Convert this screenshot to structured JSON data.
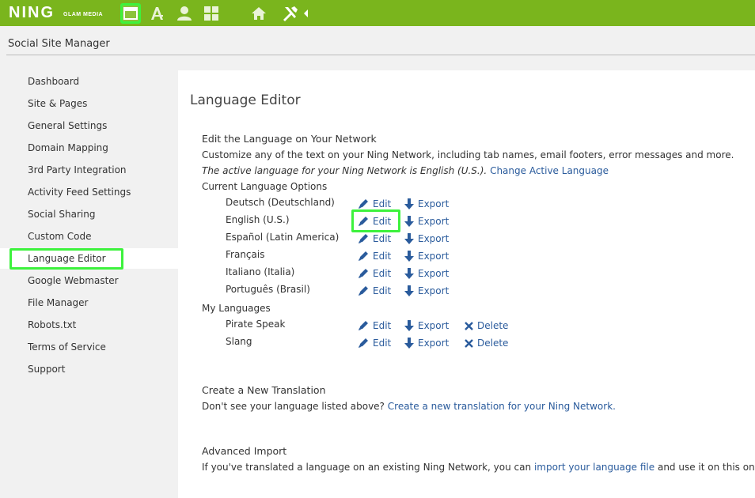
{
  "topbar": {
    "logo": "NING",
    "logo_sub": "GLAM MEDIA",
    "icons": [
      "window-icon",
      "appearance-icon",
      "profile-icon",
      "features-icon",
      "home-icon",
      "tools-icon",
      "chevron-left-icon"
    ]
  },
  "header": {
    "title": "Social Site Manager"
  },
  "sidebar": {
    "items": [
      {
        "label": "Dashboard"
      },
      {
        "label": "Site & Pages"
      },
      {
        "label": "General Settings"
      },
      {
        "label": "Domain Mapping"
      },
      {
        "label": "3rd Party Integration"
      },
      {
        "label": "Activity Feed Settings"
      },
      {
        "label": "Social Sharing"
      },
      {
        "label": "Custom Code"
      },
      {
        "label": "Language Editor"
      },
      {
        "label": "Google Webmaster"
      },
      {
        "label": "File Manager"
      },
      {
        "label": "Robots.txt"
      },
      {
        "label": "Terms of Service"
      },
      {
        "label": "Support"
      }
    ]
  },
  "main": {
    "title": "Language Editor",
    "edit_section": {
      "title": "Edit the Language on Your Network",
      "description": "Customize any of the text on your Ning Network, including tab names, email footers, error messages and more.",
      "active_text": "The active language for your Ning Network is English (U.S.).",
      "change_link": "Change Active Language",
      "current_title": "Current Language Options",
      "languages": [
        {
          "name": "Deutsch (Deutschland)"
        },
        {
          "name": "English (U.S.)"
        },
        {
          "name": "Español (Latin America)"
        },
        {
          "name": "Français"
        },
        {
          "name": "Italiano (Italia)"
        },
        {
          "name": "Português (Brasil)"
        }
      ],
      "my_title": "My Languages",
      "my_languages": [
        {
          "name": "Pirate Speak"
        },
        {
          "name": "Slang"
        }
      ],
      "edit_label": "Edit",
      "export_label": "Export",
      "delete_label": "Delete"
    },
    "create_section": {
      "title": "Create a New Translation",
      "text": "Don't see your language listed above?",
      "link": "Create a new translation for your Ning Network."
    },
    "import_section": {
      "title": "Advanced Import",
      "text_before": "If you've translated a language on an existing Ning Network, you can",
      "link": "import your language file",
      "text_after": "and use it on this one."
    }
  },
  "colors": {
    "brand_green": "#7ab51d",
    "link_blue": "#2a5b9c",
    "highlight": "#3df23d"
  }
}
